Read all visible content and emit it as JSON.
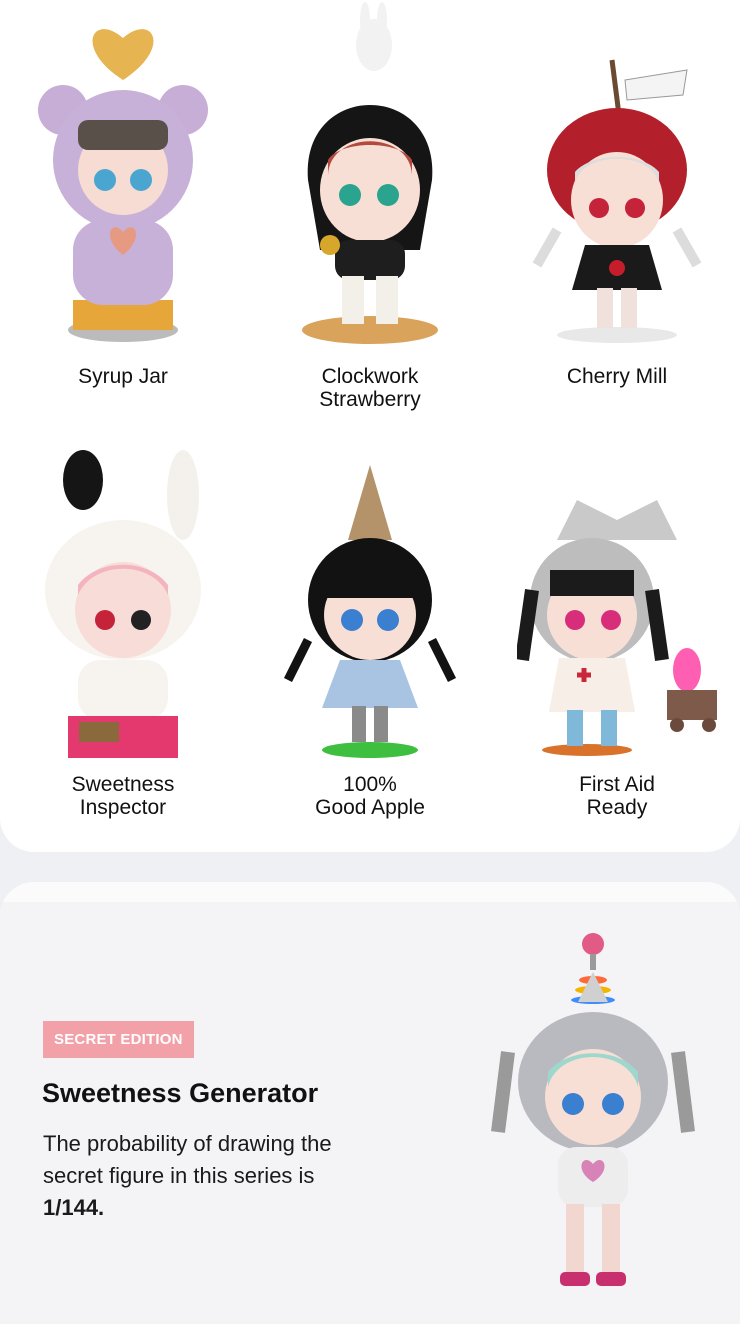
{
  "figures": [
    {
      "name": "Syrup Jar"
    },
    {
      "name": "Clockwork\nStrawberry"
    },
    {
      "name": "Cherry Mill"
    },
    {
      "name": "Sweetness\nInspector"
    },
    {
      "name": "100%\nGood Apple"
    },
    {
      "name": "First Aid\nReady"
    }
  ],
  "secret": {
    "badge": "SECRET EDITION",
    "title": "Sweetness Generator",
    "desc_prefix": "The probability of drawing the secret figure in this series is ",
    "probability": "1/144."
  },
  "colors": {
    "badge_bg": "#f2a1a8",
    "page_bg": "#eef0f4",
    "card_bg": "#ffffff",
    "secret_bg": "#f4f4f6"
  },
  "figure_icons": [
    "syrup-jar-bear-figure",
    "clockwork-strawberry-figure",
    "cherry-mill-figure",
    "sweetness-inspector-bunny-figure",
    "good-apple-figure",
    "first-aid-ready-figure",
    "sweetness-generator-figure"
  ]
}
